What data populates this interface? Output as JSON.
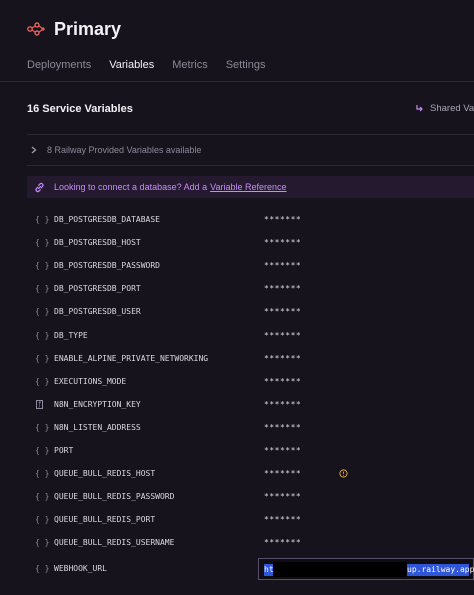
{
  "service": {
    "title": "Primary",
    "icon": "service-nodes-icon"
  },
  "tabs": [
    {
      "label": "Deployments",
      "active": false
    },
    {
      "label": "Variables",
      "active": true
    },
    {
      "label": "Metrics",
      "active": false
    },
    {
      "label": "Settings",
      "active": false
    }
  ],
  "variables_section": {
    "heading": "16 Service Variables",
    "shared_label": "Shared Vari",
    "railway_provided": "8 Railway Provided Variables available",
    "banner": {
      "text": "Looking to connect a database? Add a",
      "link": "Variable Reference"
    }
  },
  "variables": [
    {
      "key": "DB_POSTGRESDB_DATABASE",
      "value": "*******",
      "icon": "braces-icon"
    },
    {
      "key": "DB_POSTGRESDB_HOST",
      "value": "*******",
      "icon": "braces-icon"
    },
    {
      "key": "DB_POSTGRESDB_PASSWORD",
      "value": "*******",
      "icon": "braces-icon"
    },
    {
      "key": "DB_POSTGRESDB_PORT",
      "value": "*******",
      "icon": "braces-icon"
    },
    {
      "key": "DB_POSTGRESDB_USER",
      "value": "*******",
      "icon": "braces-icon"
    },
    {
      "key": "DB_TYPE",
      "value": "*******",
      "icon": "braces-icon"
    },
    {
      "key": "ENABLE_ALPINE_PRIVATE_NETWORKING",
      "value": "*******",
      "icon": "braces-icon"
    },
    {
      "key": "EXECUTIONS_MODE",
      "value": "*******",
      "icon": "braces-icon"
    },
    {
      "key": "N8N_ENCRYPTION_KEY",
      "value": "*******",
      "icon": "function-box-icon"
    },
    {
      "key": "N8N_LISTEN_ADDRESS",
      "value": "*******",
      "icon": "braces-icon"
    },
    {
      "key": "PORT",
      "value": "*******",
      "icon": "braces-icon"
    },
    {
      "key": "QUEUE_BULL_REDIS_HOST",
      "value": "*******",
      "icon": "braces-icon",
      "warning": true
    },
    {
      "key": "QUEUE_BULL_REDIS_PASSWORD",
      "value": "*******",
      "icon": "braces-icon"
    },
    {
      "key": "QUEUE_BULL_REDIS_PORT",
      "value": "*******",
      "icon": "braces-icon"
    },
    {
      "key": "QUEUE_BULL_REDIS_USERNAME",
      "value": "*******",
      "icon": "braces-icon"
    }
  ],
  "webhook": {
    "key": "WEBHOOK_URL",
    "value_start": "ht",
    "value_end": "up.railway.app"
  },
  "colors": {
    "background": "#16131d",
    "accent": "#c58ef7",
    "service_icon": "#e8615a",
    "selection": "#2f56d8",
    "warning": "#e0a43c"
  }
}
